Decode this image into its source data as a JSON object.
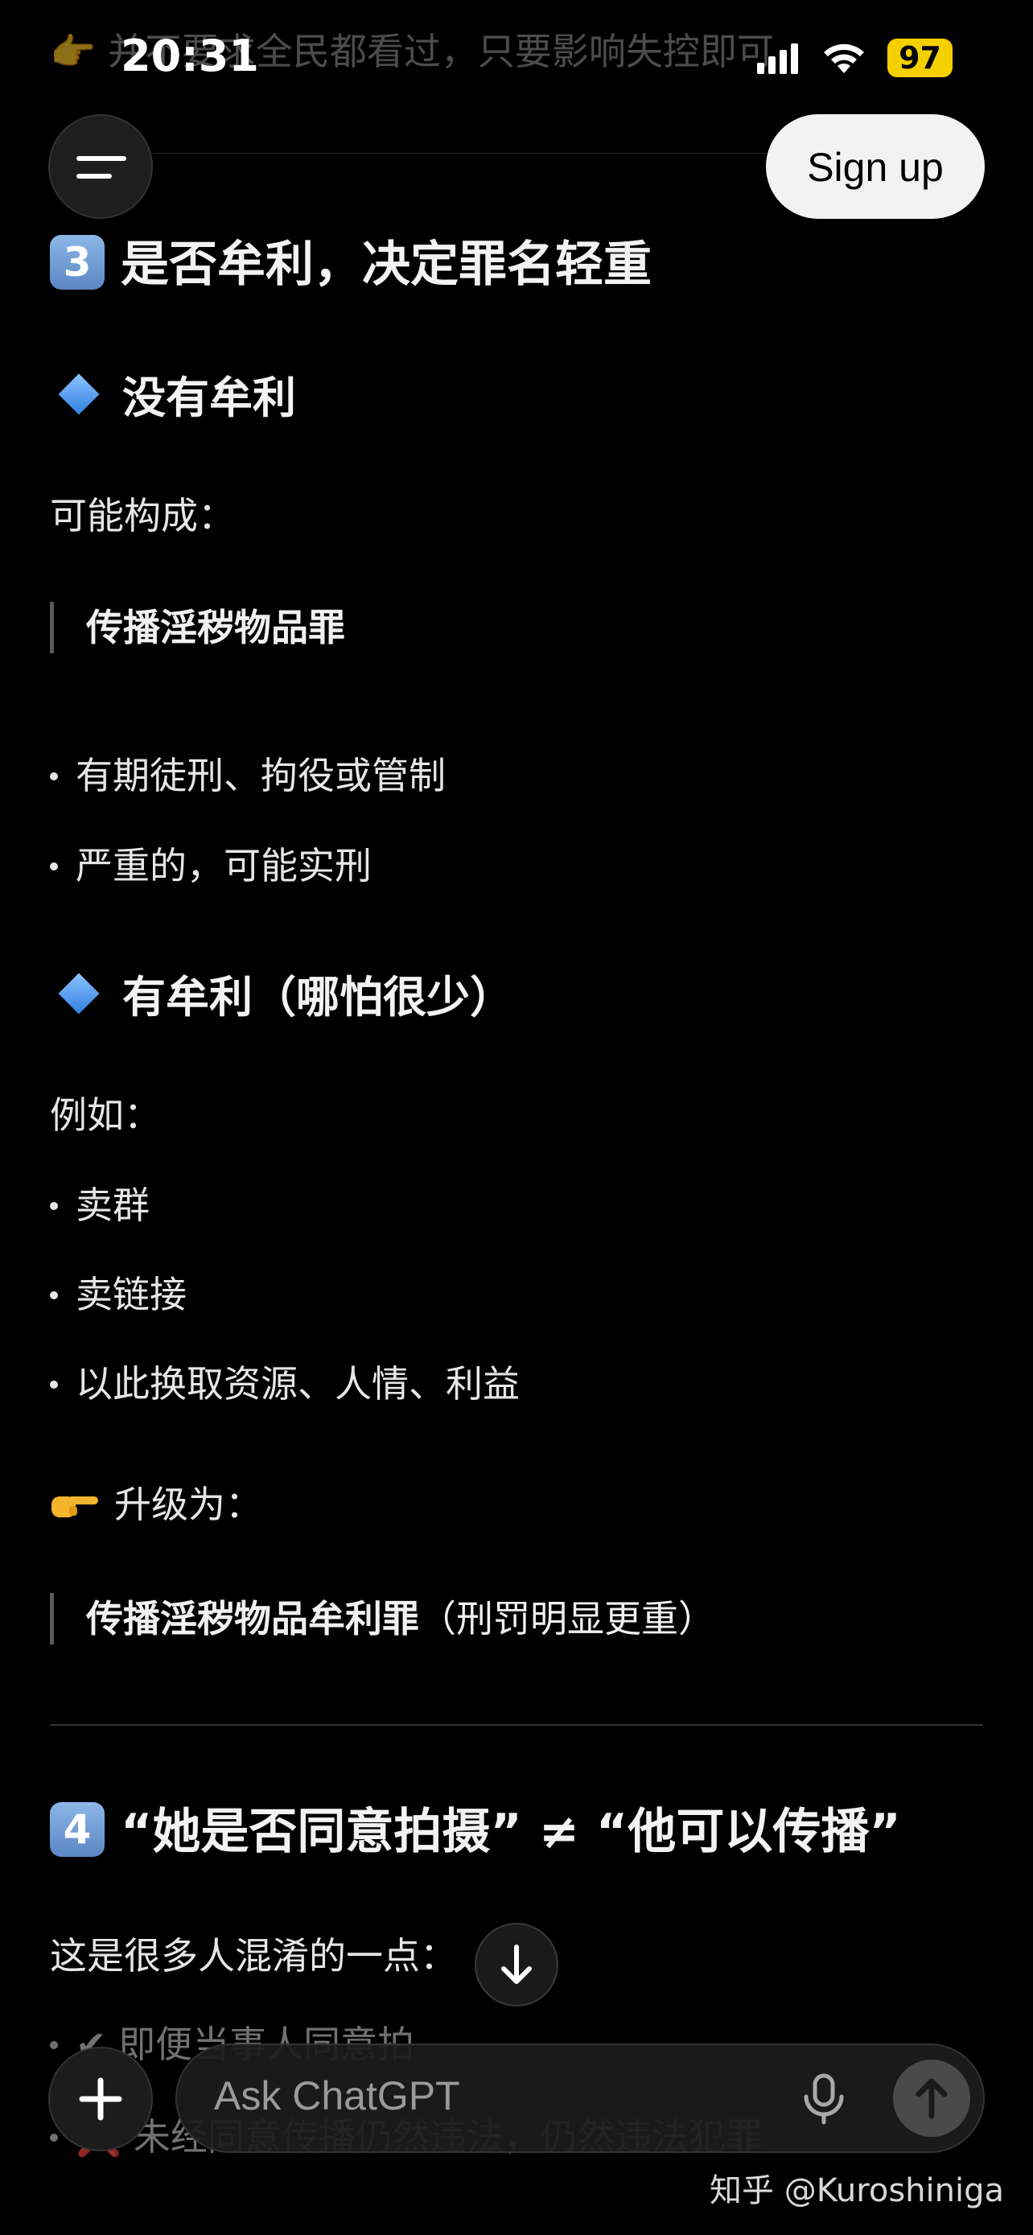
{
  "status_bar": {
    "time": "20:31",
    "battery": "97"
  },
  "header": {
    "signup_label": "Sign up"
  },
  "faded_top_text": "👉 并不要求全民都看过，只要影响失控即可",
  "section3": {
    "number": "3",
    "title": "是否牟利，决定罪名轻重",
    "no_profit": {
      "heading": "没有牟利",
      "intro": "可能构成：",
      "quote": "传播淫秽物品罪",
      "bullets": [
        "有期徒刑、拘役或管制",
        "严重的，可能实刑"
      ]
    },
    "profit": {
      "heading": "有牟利（哪怕很少）",
      "intro": "例如：",
      "bullets": [
        "卖群",
        "卖链接",
        "以此换取资源、人情、利益"
      ],
      "upgrade": "升级为：",
      "quote_bold": "传播淫秽物品牟利罪",
      "quote_normal": "（刑罚明显更重）"
    }
  },
  "section4": {
    "number": "4",
    "title": "“她是否同意拍摄” ≠ “他可以传播”",
    "intro": "这是很多人混淆的一点：",
    "bullets_partial": [
      "✔ 即便当事人同意拍",
      "❌ 未经同意传播仍然违法，仍然违法犯罪"
    ]
  },
  "composer": {
    "placeholder": "Ask ChatGPT"
  },
  "watermark": "知乎 @Kuroshiniga",
  "icons": {
    "menu": "menu-icon",
    "plus": "plus-icon",
    "mic": "mic-icon",
    "send": "arrow-up-icon",
    "scroll": "arrow-down-icon"
  }
}
